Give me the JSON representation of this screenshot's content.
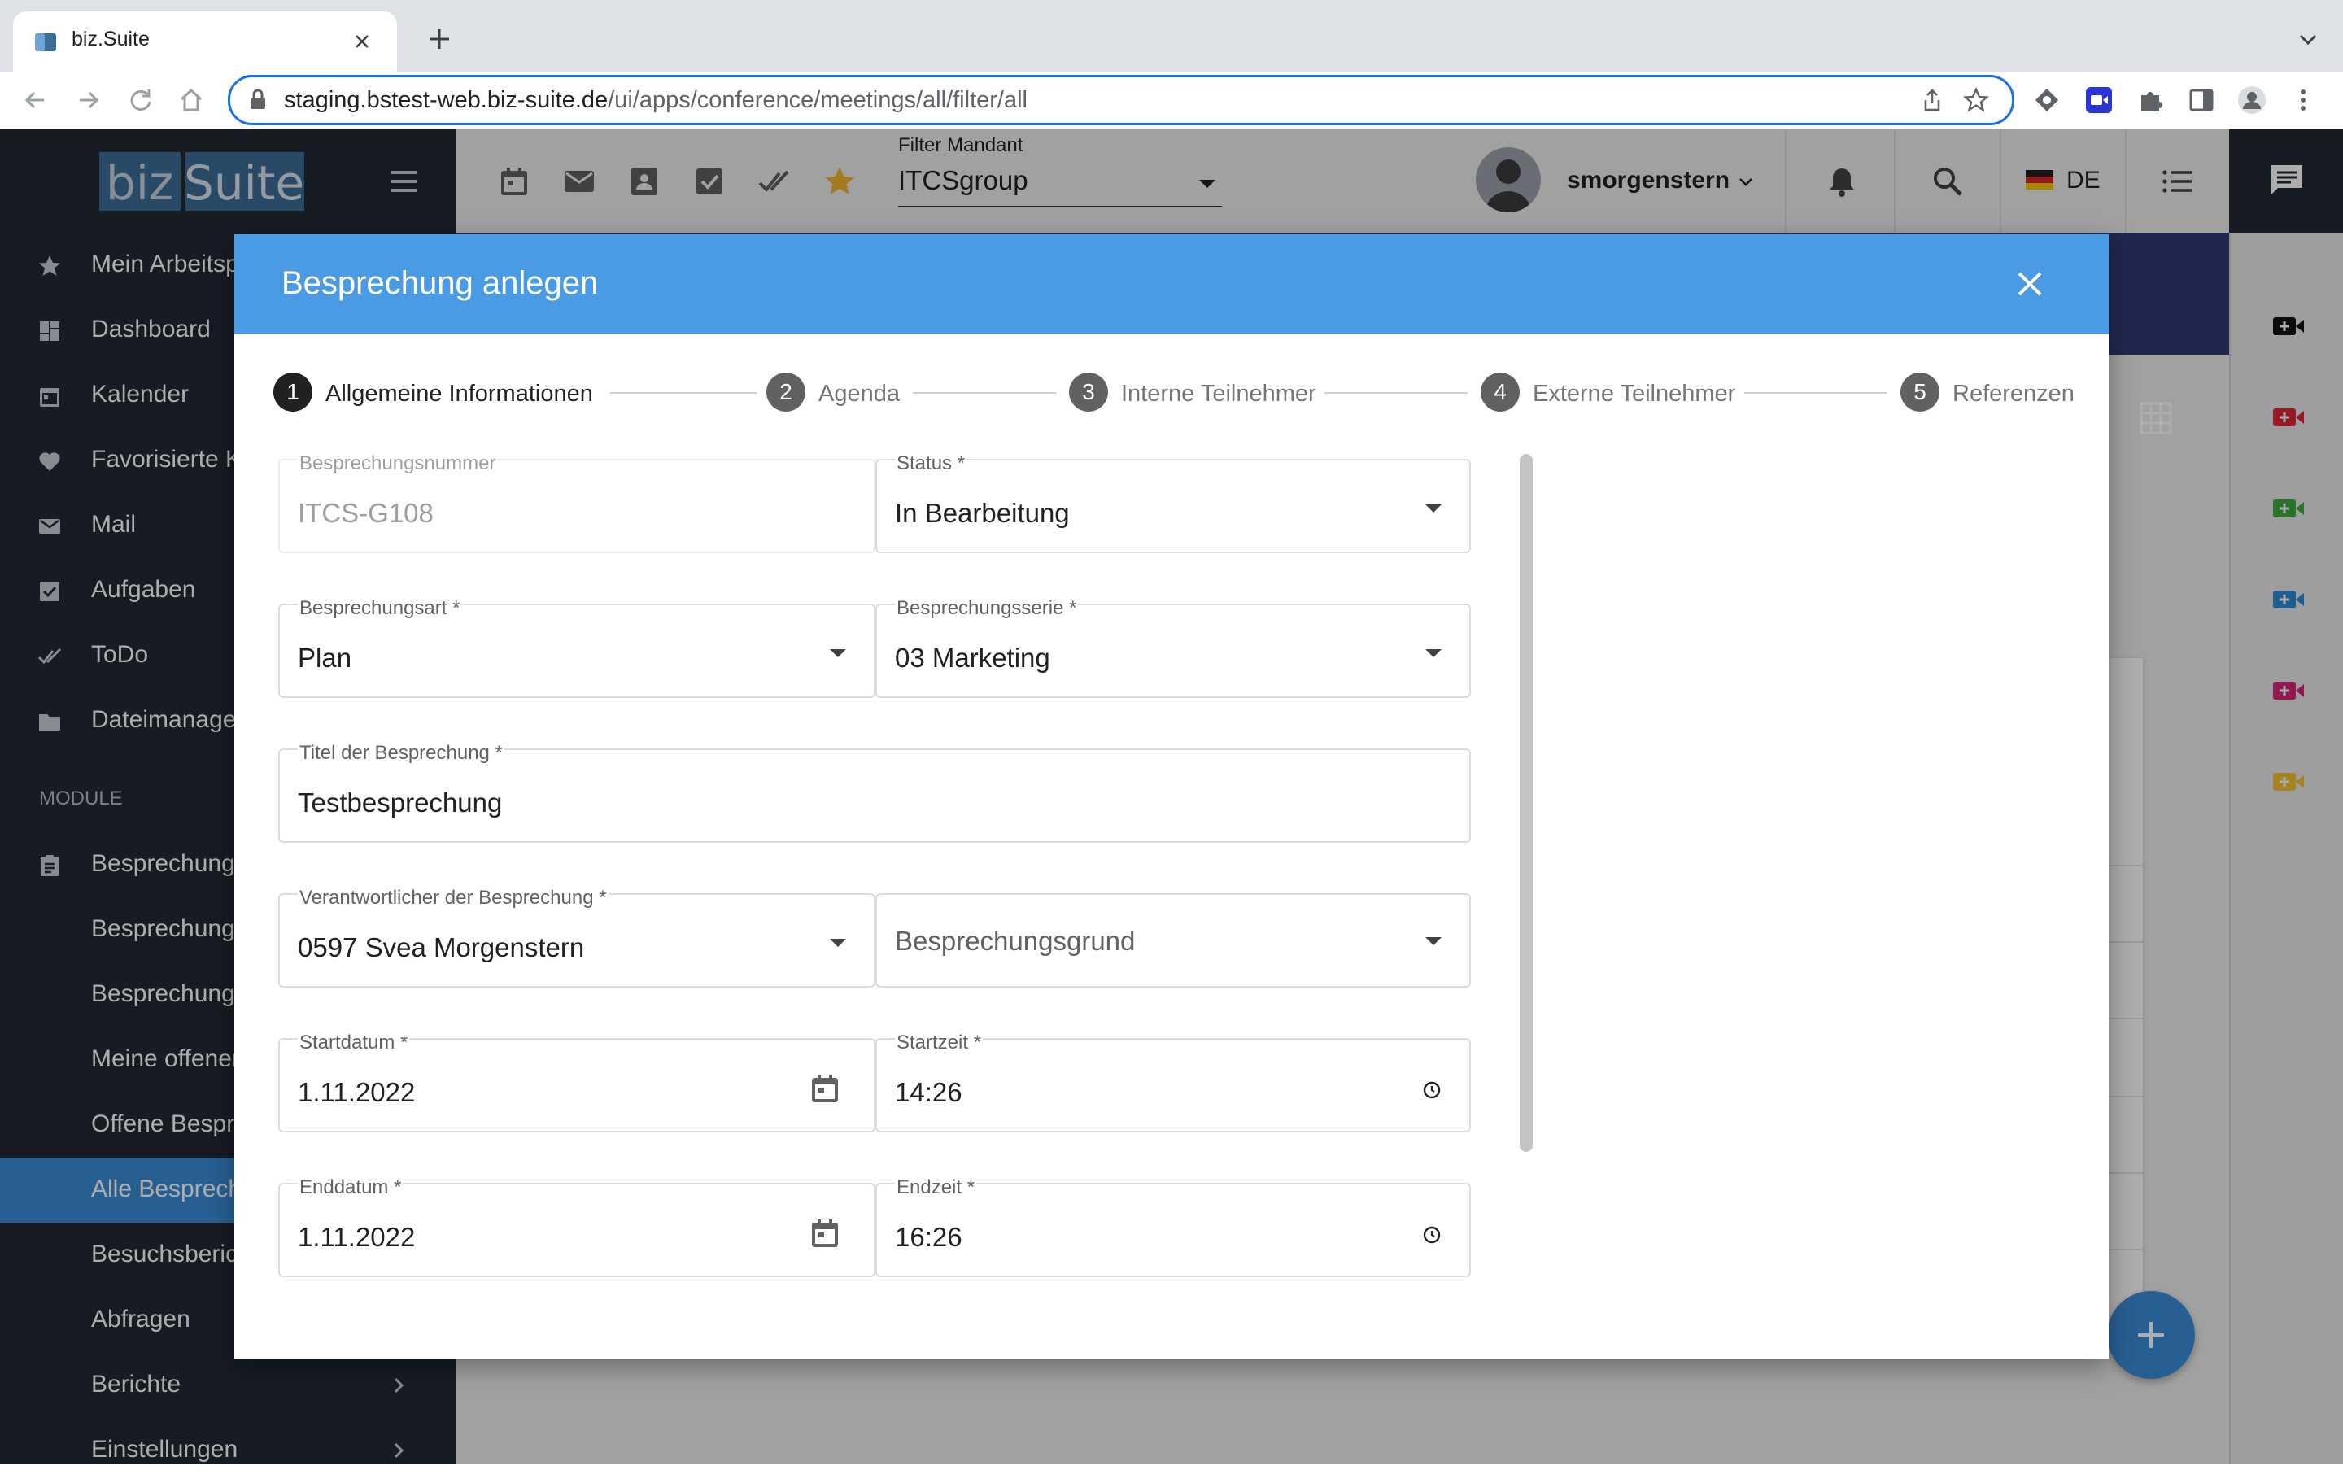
{
  "browser": {
    "tab_title": "biz.Suite",
    "url_host": "staging.bstest-web.biz-suite.de",
    "url_path": "/ui/apps/conference/meetings/all/filter/all"
  },
  "header": {
    "logo_part1": "biz",
    "logo_part2": "Suite",
    "filter_label": "Filter Mandant",
    "filter_value": "ITCSgroup",
    "user_name": "smorgenstern",
    "language": "DE"
  },
  "sidebar": {
    "items": [
      {
        "label": "Mein Arbeitsplatz",
        "icon": "star-icon"
      },
      {
        "label": "Dashboard",
        "icon": "dashboard-icon"
      },
      {
        "label": "Kalender",
        "icon": "calendar-icon"
      },
      {
        "label": "Favorisierte Kontakte",
        "icon": "heart-icon"
      },
      {
        "label": "Mail",
        "icon": "mail-icon"
      },
      {
        "label": "Aufgaben",
        "icon": "checkbox-icon"
      },
      {
        "label": "ToDo",
        "icon": "double-check-icon"
      },
      {
        "label": "Dateimanager",
        "icon": "folder-icon"
      }
    ],
    "module_header": "MODULE",
    "module_items": [
      {
        "label": "Besprechungen",
        "icon": "clipboard-icon"
      },
      {
        "label": "Besprechungsserien"
      },
      {
        "label": "Besprechungsarten"
      },
      {
        "label": "Meine offenen Besprechungen"
      },
      {
        "label": "Offene Besprechungen"
      },
      {
        "label": "Alle Besprechungen",
        "active": true
      },
      {
        "label": "Besuchsberichte"
      },
      {
        "label": "Abfragen"
      },
      {
        "label": "Berichte",
        "has_children": true
      },
      {
        "label": "Einstellungen",
        "has_children": true
      }
    ]
  },
  "dialog": {
    "title": "Besprechung anlegen",
    "steps": [
      {
        "num": "1",
        "label": "Allgemeine Informationen",
        "active": true
      },
      {
        "num": "2",
        "label": "Agenda"
      },
      {
        "num": "3",
        "label": "Interne Teilnehmer"
      },
      {
        "num": "4",
        "label": "Externe Teilnehmer"
      },
      {
        "num": "5",
        "label": "Referenzen"
      }
    ],
    "fields": {
      "number": {
        "label": "Besprechungsnummer",
        "value": "ITCS-G108"
      },
      "status": {
        "label": "Status *",
        "value": "In Bearbeitung"
      },
      "type": {
        "label": "Besprechungsart *",
        "value": "Plan"
      },
      "series": {
        "label": "Besprechungsserie *",
        "value": "03 Marketing"
      },
      "title": {
        "label": "Titel der Besprechung *",
        "value": "Testbesprechung"
      },
      "responsible": {
        "label": "Verantwortlicher der Besprechung *",
        "value": "0597 Svea Morgenstern"
      },
      "reason": {
        "placeholder": "Besprechungsgrund"
      },
      "start_date": {
        "label": "Startdatum *",
        "value": "1.11.2022"
      },
      "start_time": {
        "label": "Startzeit *",
        "value": "14:26"
      },
      "end_date": {
        "label": "Enddatum *",
        "value": "1.11.2022"
      },
      "end_time": {
        "label": "Endzeit *",
        "value": "16:26"
      }
    }
  },
  "colors": {
    "accent": "#4a9be3",
    "sidebar_bg": "#212a33",
    "active_item": "#3c8dd8",
    "star_gold": "#f2b632"
  }
}
